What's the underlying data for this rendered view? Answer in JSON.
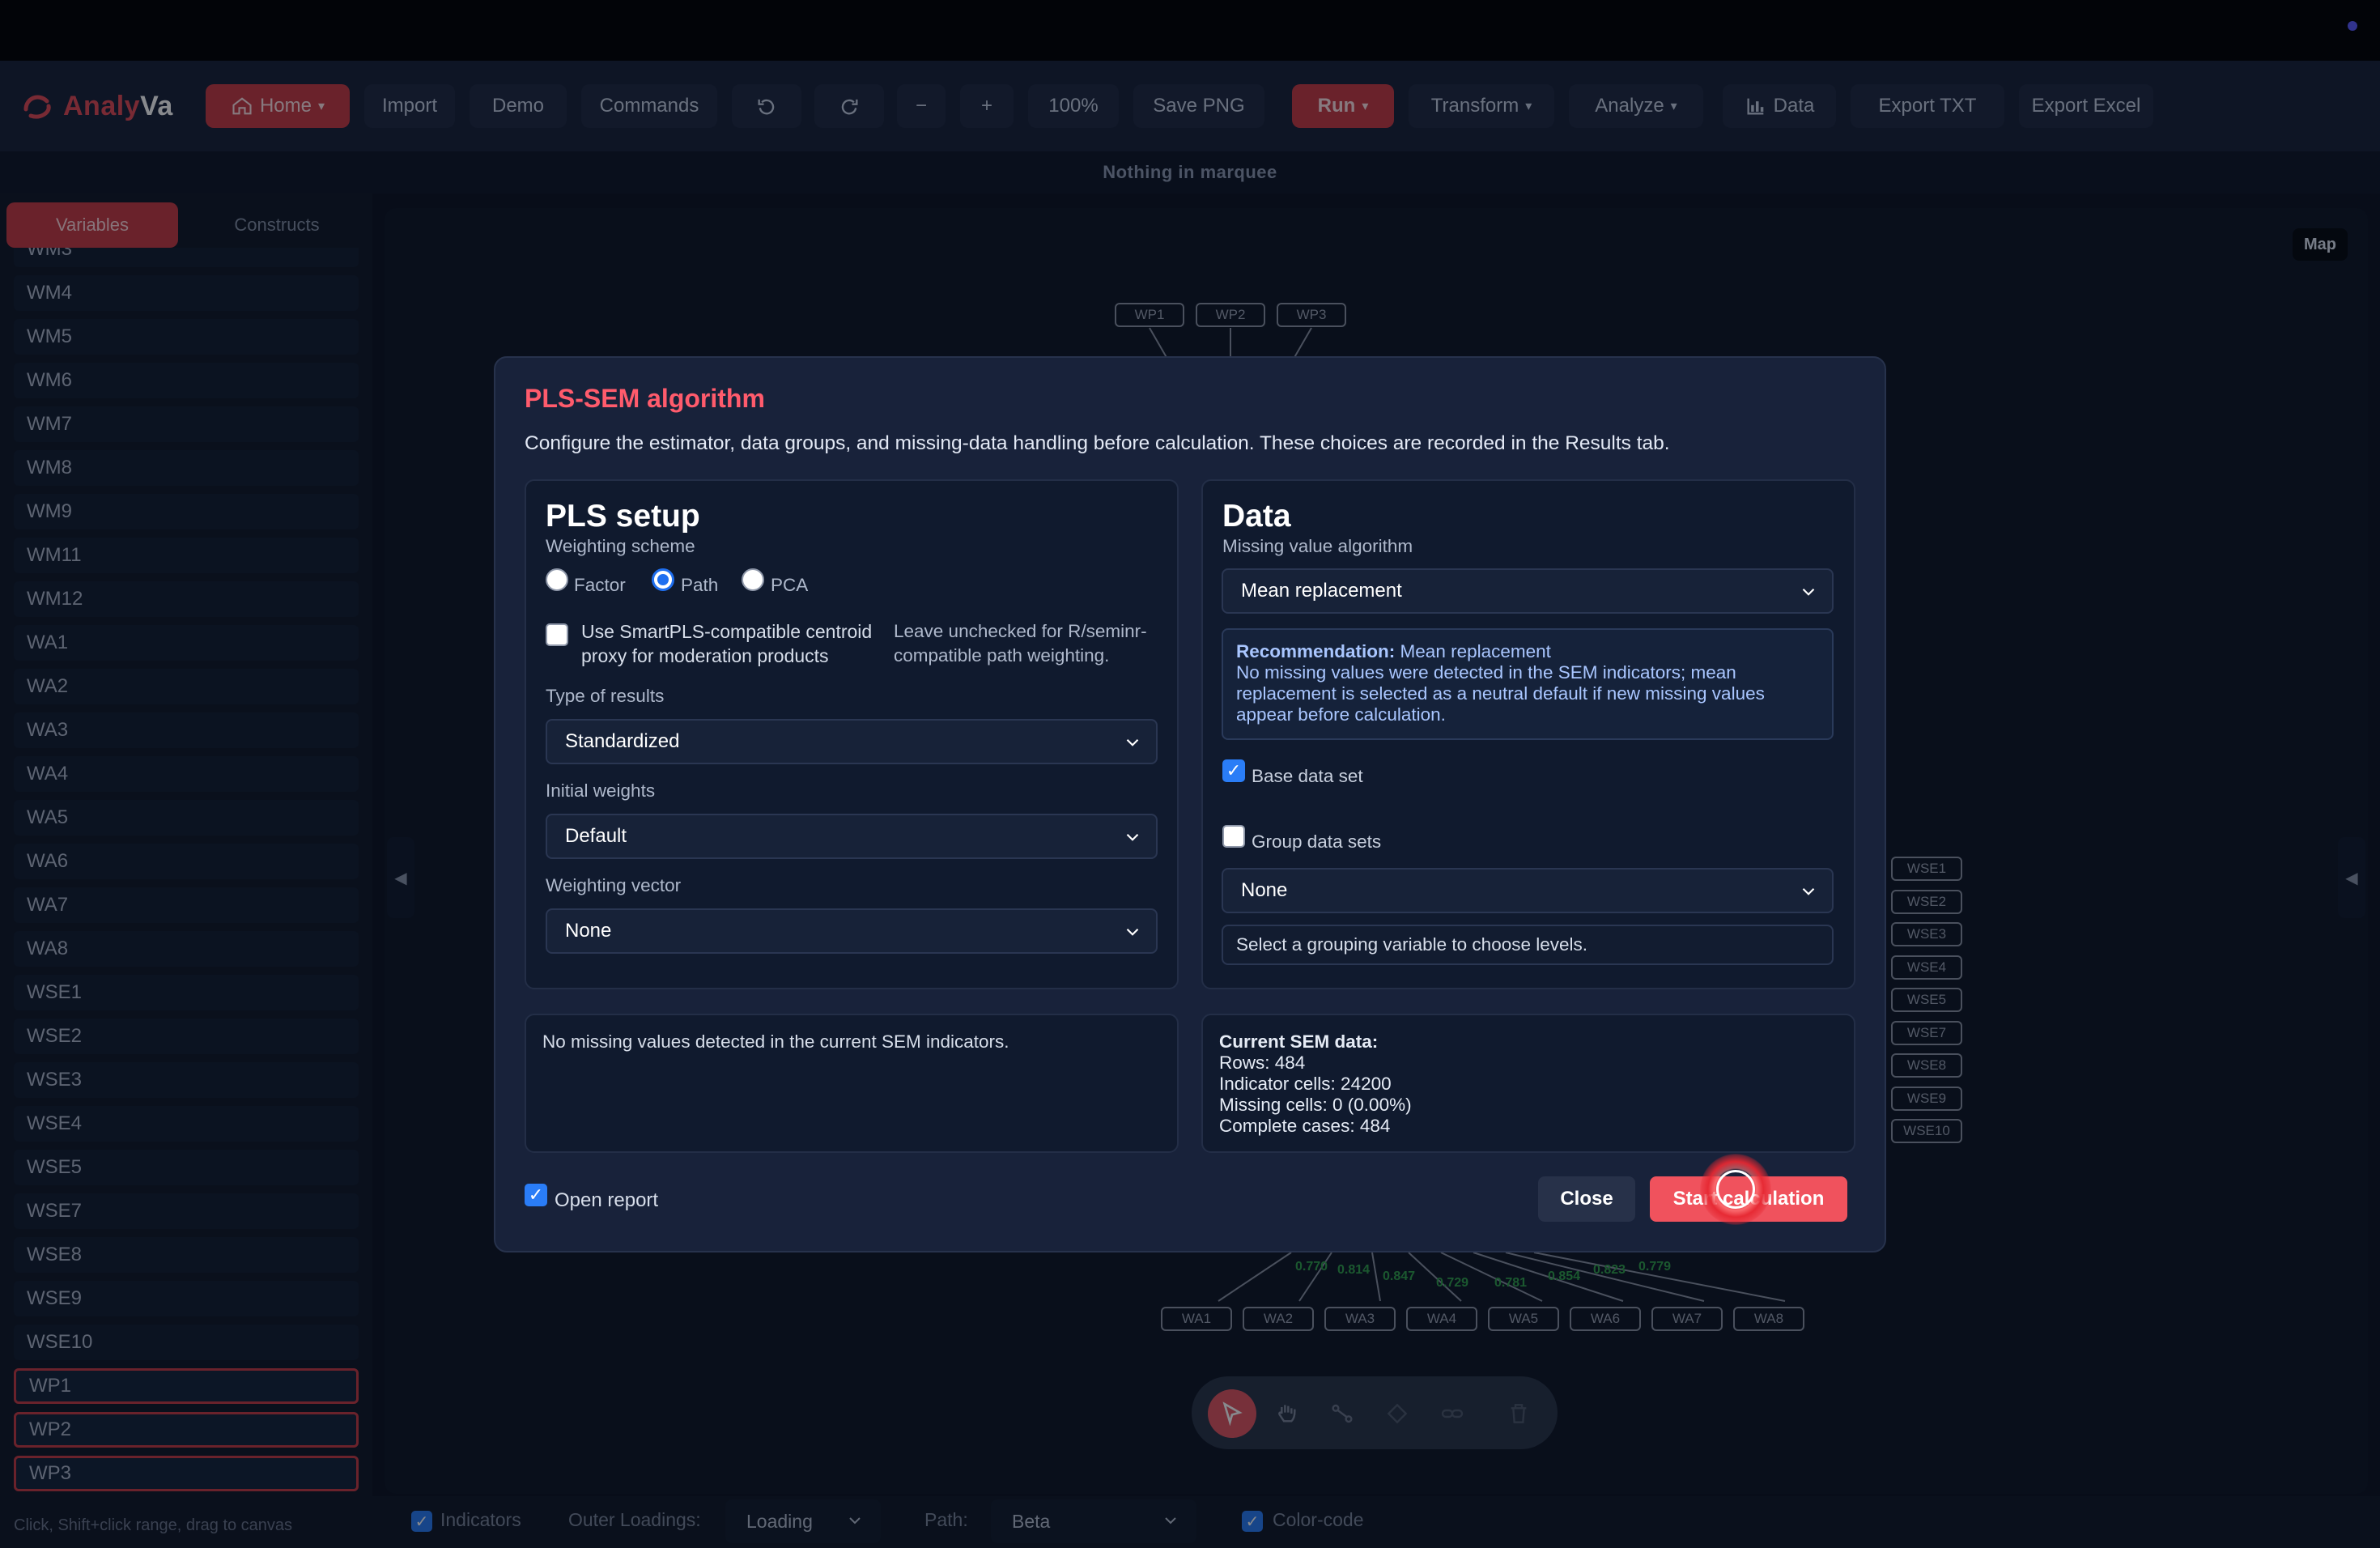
{
  "app": {
    "logo_a": "Analy",
    "logo_b": "Va"
  },
  "toolbar": {
    "home": "Home",
    "import": "Import",
    "demo": "Demo",
    "commands": "Commands",
    "zoom_out": "−",
    "zoom_in": "+",
    "zoom": "100%",
    "save_png": "Save PNG",
    "run": "Run",
    "transform": "Transform",
    "analyze": "Analyze",
    "data": "Data",
    "export_txt": "Export TXT",
    "export_excel": "Export Excel"
  },
  "marquee": "Nothing in marquee",
  "left_panel": {
    "tabs": [
      "Variables",
      "Constructs"
    ],
    "variables": [
      "WM3",
      "WM4",
      "WM5",
      "WM6",
      "WM7",
      "WM8",
      "WM9",
      "WM11",
      "WM12",
      "WA1",
      "WA2",
      "WA3",
      "WA4",
      "WA5",
      "WA6",
      "WA7",
      "WA8",
      "WSE1",
      "WSE2",
      "WSE3",
      "WSE4",
      "WSE5",
      "WSE7",
      "WSE8",
      "WSE9",
      "WSE10",
      "WP1",
      "WP2",
      "WP3"
    ],
    "selected": [
      "WP1",
      "WP2",
      "WP3"
    ],
    "hint": "Click, Shift+click range, drag to canvas"
  },
  "canvas": {
    "map": "Map",
    "top_indicators": [
      "WP1",
      "WP2",
      "WP3"
    ],
    "right_indicators": [
      "WSE1",
      "WSE2",
      "WSE3",
      "WSE4",
      "WSE5",
      "WSE7",
      "WSE8",
      "WSE9",
      "WSE10"
    ],
    "bottom_indicators": [
      "WA1",
      "WA2",
      "WA3",
      "WA4",
      "WA5",
      "WA6",
      "WA7",
      "WA8"
    ],
    "loadings": [
      "0.770",
      "0.814",
      "0.847",
      "0.729",
      "0.781",
      "0.854",
      "0.823",
      "0.779"
    ]
  },
  "bottom_bar": {
    "indicators": "Indicators",
    "outer_loadings_label": "Outer Loadings:",
    "outer_loadings_value": "Loading",
    "path_label": "Path:",
    "path_value": "Beta",
    "color_code": "Color-code"
  },
  "modal": {
    "title": "PLS-SEM algorithm",
    "description": "Configure the estimator, data groups, and missing-data handling before calculation. These choices are recorded in the Results tab.",
    "pls_setup": {
      "heading": "PLS setup",
      "weighting_scheme_label": "Weighting scheme",
      "options": [
        "Factor",
        "Path",
        "PCA"
      ],
      "selected_option": "Path",
      "centroid_line1": "Use SmartPLS-compatible centroid",
      "centroid_line2": "proxy for moderation products",
      "centroid_note_line1": "Leave unchecked for R/seminr-",
      "centroid_note_line2": "compatible path weighting.",
      "type_of_results_label": "Type of results",
      "type_of_results_value": "Standardized",
      "initial_weights_label": "Initial weights",
      "initial_weights_value": "Default",
      "weighting_vector_label": "Weighting vector",
      "weighting_vector_value": "None"
    },
    "data": {
      "heading": "Data",
      "missing_value_label": "Missing value algorithm",
      "missing_value_value": "Mean replacement",
      "recommendation_label": "Recommendation:",
      "recommendation_value": "Mean replacement",
      "rec_line1": "No missing values were detected in the SEM indicators; mean",
      "rec_line2": "replacement is selected as a neutral default if new missing values",
      "rec_line3": "appear before calculation.",
      "base_data_set": "Base data set",
      "group_data_sets": "Group data sets",
      "group_value": "None",
      "group_hint": "Select a grouping variable to choose levels."
    },
    "missing_info": "No missing values detected in the current SEM indicators.",
    "current_sem": {
      "heading": "Current SEM data:",
      "rows": "Rows: 484",
      "indicator_cells": "Indicator cells: 24200",
      "missing_cells": "Missing cells: 0 (0.00%)",
      "complete_cases": "Complete cases: 484"
    },
    "open_report": "Open report",
    "close": "Close",
    "start": "Start calculation"
  },
  "colors": {
    "accent": "#c83a43",
    "title": "#ff5b6c",
    "primary_button": "#f0525d",
    "loading_green": "#31a24c"
  }
}
